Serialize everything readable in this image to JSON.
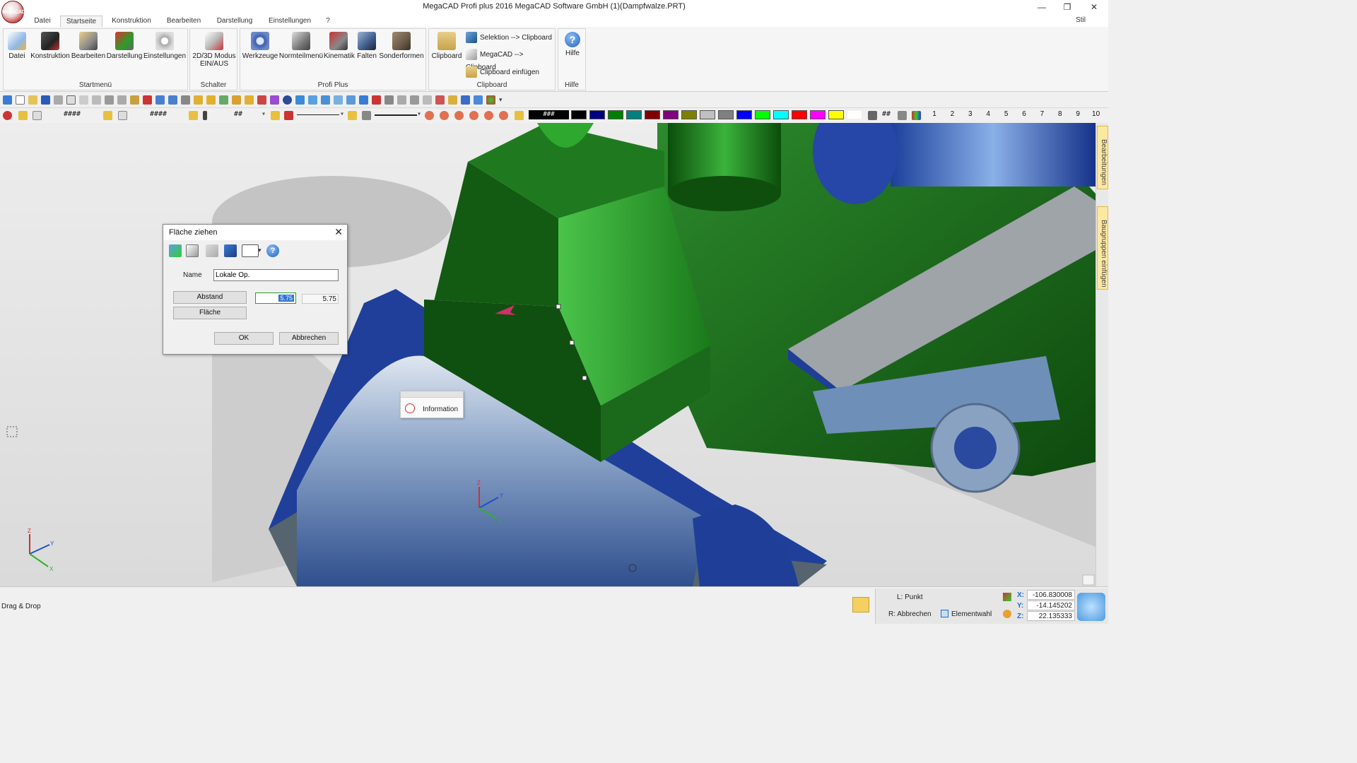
{
  "app": {
    "title": "MegaCAD Profi plus 2016  MegaCAD Software GmbH (1)(Dampfwalze.PRT)",
    "logo_text": "MegaCAD",
    "style_label": "Stil"
  },
  "window_controls": {
    "minimize": "—",
    "restore": "❐",
    "close": "✕"
  },
  "menu_tabs": [
    "Datei",
    "Startseite",
    "Konstruktion",
    "Bearbeiten",
    "Darstellung",
    "Einstellungen",
    "?"
  ],
  "ribbon": {
    "groups": [
      {
        "label": "Startmenü",
        "buttons": [
          "Datei",
          "Konstruktion",
          "Bearbeiten",
          "Darstellung",
          "Einstellungen"
        ]
      },
      {
        "label": "Schalter",
        "buttons": [
          "2D/3D Modus EIN/AUS"
        ]
      },
      {
        "label": "Profi Plus",
        "buttons": [
          "Werkzeuge",
          "Normteilmenü",
          "Kinematik",
          "Falten",
          "Sonderformen"
        ]
      },
      {
        "label": "Clipboard",
        "main": "Clipboard",
        "items": [
          "Selektion --> Clipboard",
          "MegaCAD --> Clipboard",
          "Clipboard einfügen"
        ]
      },
      {
        "label": "Hilfe",
        "buttons": [
          "Hilfe"
        ]
      }
    ]
  },
  "toolbar2": {
    "layer_a": "####",
    "layer_b": "####",
    "layer_c": "##",
    "color_field": "###",
    "grid_label": "##",
    "colors": [
      "#000000",
      "#000080",
      "#008000",
      "#008080",
      "#800000",
      "#800080",
      "#808000",
      "#c0c0c0",
      "#808080",
      "#0000ff",
      "#00ff00",
      "#00ffff",
      "#ff0000",
      "#ff00ff",
      "#ffff00",
      "#ffffff"
    ],
    "levels": [
      "1",
      "2",
      "3",
      "4",
      "5",
      "6",
      "7",
      "8",
      "9",
      "10"
    ]
  },
  "side_tabs": [
    "Bearbeitungen",
    "Baugruppen einfügen"
  ],
  "dialog": {
    "title": "Fläche ziehen",
    "close": "✕",
    "name_label": "Name",
    "name_value": "Lokale Op.",
    "abstand_label": "Abstand",
    "flaeche_label": "Fläche",
    "value_input": "5.75",
    "value_readout": "5.75",
    "ok_label": "OK",
    "cancel_label": "Abbrechen"
  },
  "info_popup": {
    "text": "Information"
  },
  "viewport_axes": {
    "scene": {
      "z": "Z",
      "y": "Y",
      "x": "X"
    },
    "corner": {
      "z": "Z",
      "y": "Y",
      "x": "X"
    }
  },
  "statusbar": {
    "mode": "Drag & Drop",
    "left_click": "L: Punkt",
    "right_click": "R: Abbrechen",
    "element_select": "Elementwahl",
    "x_label": "X:",
    "y_label": "Y:",
    "z_label": "Z:",
    "x_value": "-106.830008",
    "y_value": "-14.145202",
    "z_value": "22.135333"
  }
}
